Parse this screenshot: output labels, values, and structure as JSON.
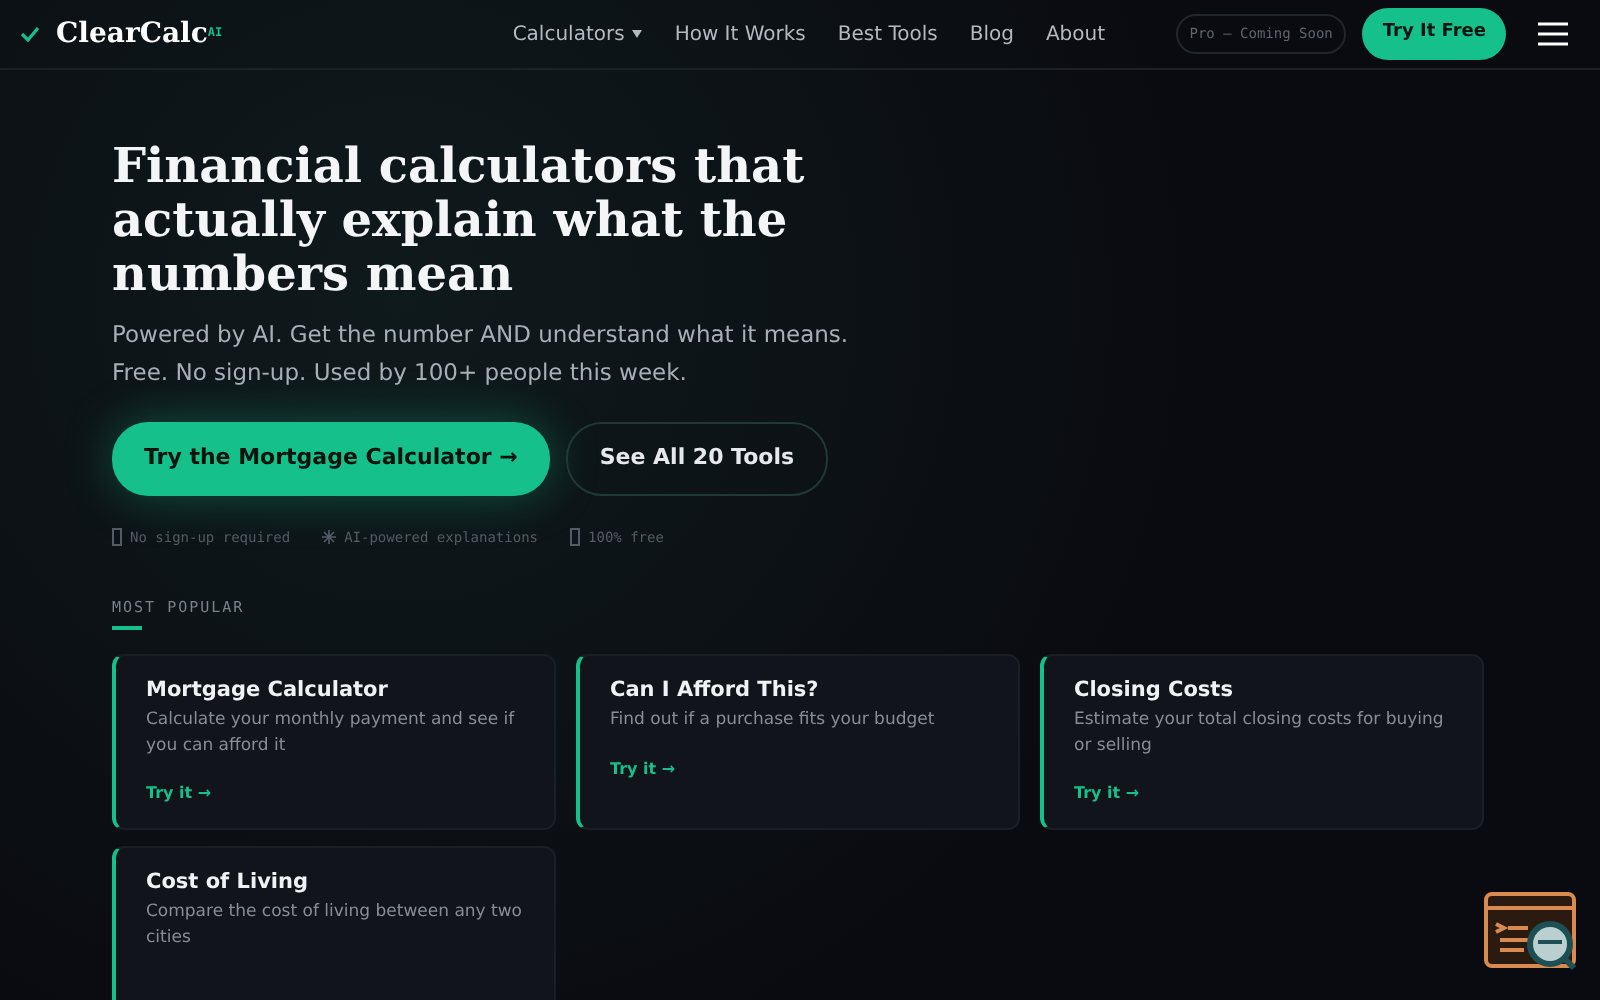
{
  "nav": {
    "logo": "ClearCalc",
    "logo_sup": "AI",
    "links": [
      {
        "label": "Calculators",
        "dropdown": true
      },
      {
        "label": "How It Works",
        "dropdown": false
      },
      {
        "label": "Best Tools",
        "dropdown": false
      },
      {
        "label": "Blog",
        "dropdown": false
      },
      {
        "label": "About",
        "dropdown": false
      }
    ],
    "pro_badge": "Pro — Coming Soon",
    "cta": "Try It Free"
  },
  "hero": {
    "title": "Financial calculators that actually explain what the numbers mean",
    "subtitle": "Powered by AI. Get the number AND understand what it means. Free. No sign-up. Used by 100+ people this week.",
    "primary_button": "Try the Mortgage Calculator →",
    "secondary_button": "See All 20 Tools",
    "features": [
      {
        "kind": "box",
        "text": "No sign-up required"
      },
      {
        "kind": "star",
        "text": "AI-powered explanations"
      },
      {
        "kind": "box",
        "text": "100% free"
      }
    ]
  },
  "popular": {
    "heading": "MOST POPULAR",
    "cards": [
      {
        "title": "Mortgage Calculator",
        "description": "Calculate your monthly payment and see if you can afford it",
        "link": "Try it →"
      },
      {
        "title": "Can I Afford This?",
        "description": "Find out if a purchase fits your budget",
        "link": "Try it →"
      },
      {
        "title": "Closing Costs",
        "description": "Estimate your total closing costs for buying or selling",
        "link": "Try it →"
      },
      {
        "title": "Cost of Living",
        "description": "Compare the cost of living between any two cities"
      }
    ]
  }
}
